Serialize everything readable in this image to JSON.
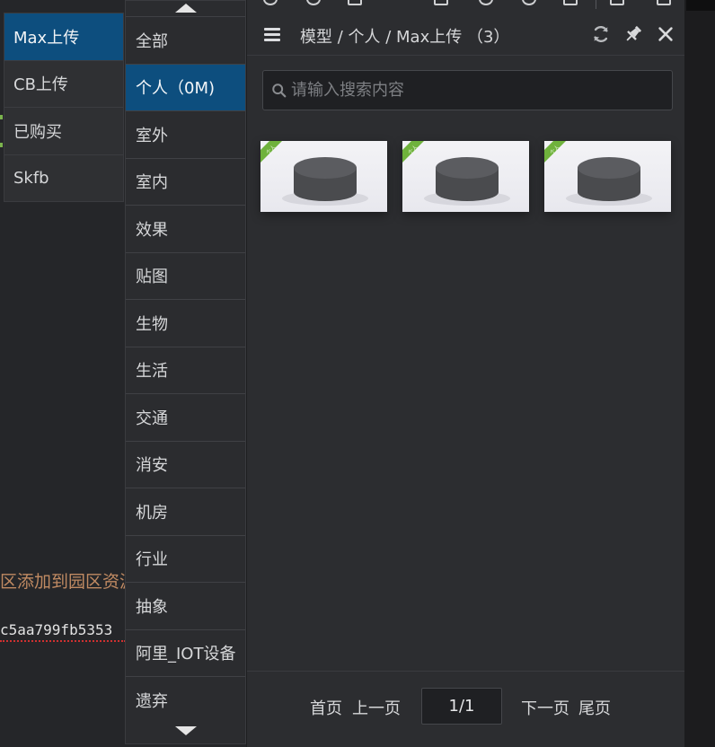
{
  "background_editor": {
    "line_cn": "区添加到园区资源",
    "line_hash": "c5aa799fb5353"
  },
  "source_menu": {
    "items": [
      {
        "label": "Max上传",
        "active": true
      },
      {
        "label": "CB上传",
        "active": false
      },
      {
        "label": "已购买",
        "active": false
      },
      {
        "label": "Skfb",
        "active": false
      }
    ]
  },
  "category_menu": {
    "items": [
      {
        "label": "全部",
        "active": false
      },
      {
        "label": "个人（0M)",
        "active": true
      },
      {
        "label": "室外",
        "active": false
      },
      {
        "label": "室内",
        "active": false
      },
      {
        "label": "效果",
        "active": false
      },
      {
        "label": "贴图",
        "active": false
      },
      {
        "label": "生物",
        "active": false
      },
      {
        "label": "生活",
        "active": false
      },
      {
        "label": "交通",
        "active": false
      },
      {
        "label": "消安",
        "active": false
      },
      {
        "label": "机房",
        "active": false
      },
      {
        "label": "行业",
        "active": false
      },
      {
        "label": "抽象",
        "active": false
      },
      {
        "label": "阿里_IOT设备",
        "active": false
      },
      {
        "label": "遗弃",
        "active": false
      }
    ],
    "scroll_up_icon": "triangle-up",
    "scroll_down_icon": "triangle-down"
  },
  "panel": {
    "breadcrumb": "模型 / 个人 / Max上传 （3）",
    "icons": {
      "menu": "hamburger",
      "refresh": "refresh",
      "pin": "pin",
      "close": "close"
    },
    "search": {
      "placeholder": "请输入搜索内容",
      "value": ""
    },
    "cards": [
      {
        "badge": "个人",
        "thumbnail": "cylinder"
      },
      {
        "badge": "个人",
        "thumbnail": "cylinder"
      },
      {
        "badge": "个人",
        "thumbnail": "cylinder"
      }
    ],
    "pagination": {
      "first": "首页",
      "prev": "上一页",
      "current": "1/1",
      "next": "下一页",
      "last": "尾页"
    }
  },
  "colors": {
    "active_bg": "#0d4e7e",
    "panel_bg": "#2c2d30",
    "badge_green": "#6fb23c"
  }
}
